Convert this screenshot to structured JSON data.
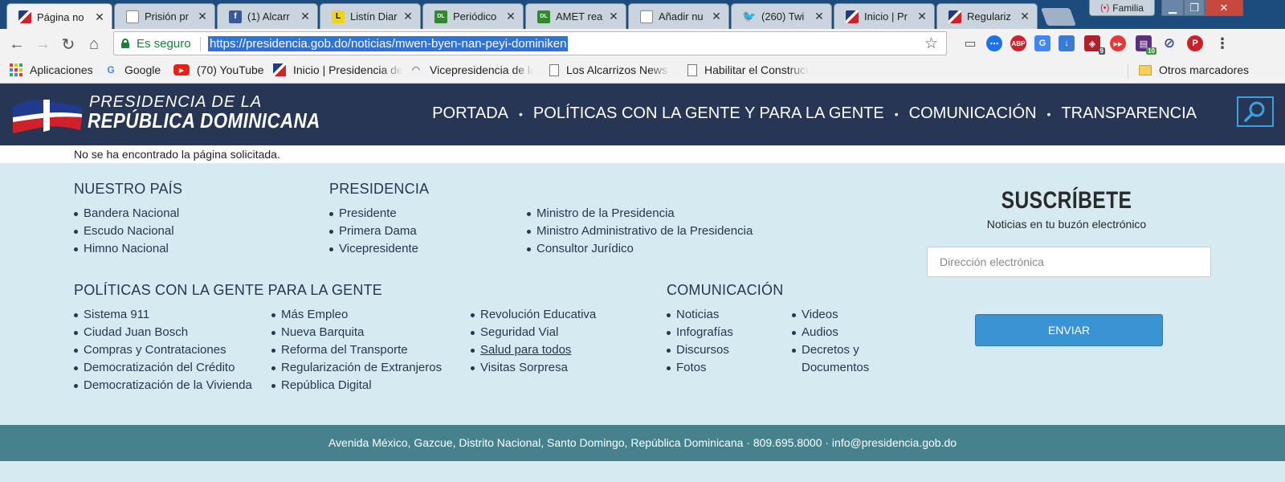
{
  "browser": {
    "tabs": [
      {
        "title": "Página no",
        "favicon": "flag-icon",
        "active": true
      },
      {
        "title": "Prisión pr",
        "favicon": "document-icon"
      },
      {
        "title": "(1) Alcarr",
        "favicon": "facebook-icon"
      },
      {
        "title": "Listín Diar",
        "favicon": "listin-icon"
      },
      {
        "title": "Periódico",
        "favicon": "diario-libre-icon"
      },
      {
        "title": "AMET rea",
        "favicon": "diario-libre-icon"
      },
      {
        "title": "Añadir nu",
        "favicon": "document-icon"
      },
      {
        "title": "(260) Twi",
        "favicon": "twitter-icon"
      },
      {
        "title": "Inicio | Pr",
        "favicon": "flag-icon"
      },
      {
        "title": "Regulariz",
        "favicon": "flag-icon"
      }
    ],
    "profile_name": "Familia",
    "secure_label": "Es seguro",
    "url": "https://presidencia.gob.do/noticias/mwen-byen-nan-peyi-dominiken",
    "extensions": [
      {
        "name": "cast-icon"
      },
      {
        "name": "messenger-icon"
      },
      {
        "name": "abp-icon",
        "text": "ABP"
      },
      {
        "name": "translate-icon"
      },
      {
        "name": "download-icon"
      },
      {
        "name": "shield-ext-icon",
        "badge": "9"
      },
      {
        "name": "media-ext-icon"
      },
      {
        "name": "calendar-ext-icon",
        "badge": "10"
      },
      {
        "name": "block-icon"
      },
      {
        "name": "pinterest-icon",
        "text": "P"
      }
    ],
    "bookmarks": [
      {
        "label": "Aplicaciones",
        "icon": "apps-icon"
      },
      {
        "label": "Google",
        "icon": "google-icon"
      },
      {
        "label": "(70) YouTube",
        "icon": "youtube-icon"
      },
      {
        "label": "Inicio | Presidencia de",
        "icon": "flag-icon"
      },
      {
        "label": "Vicepresidencia de la",
        "icon": "vicepresidencia-icon"
      },
      {
        "label": "Los Alcarrizos News D",
        "icon": "document-icon"
      },
      {
        "label": "Habilitar el Construct",
        "icon": "document-icon"
      }
    ],
    "other_bookmarks": "Otros marcadores"
  },
  "site": {
    "logo_line1": "PRESIDENCIA DE LA",
    "logo_line2": "REPÚBLICA DOMINICANA",
    "nav": [
      "PORTADA",
      "POLÍTICAS CON LA GENTE Y PARA LA GENTE",
      "COMUNICACIÓN",
      "TRANSPARENCIA"
    ],
    "nav_separator": "•",
    "error": "No se ha encontrado la página solicitada."
  },
  "footer_links": {
    "nuestro_pais": {
      "title": "NUESTRO PAÍS",
      "items": [
        "Bandera Nacional",
        "Escudo Nacional",
        "Himno Nacional"
      ]
    },
    "presidencia": {
      "title": "PRESIDENCIA",
      "col1": [
        "Presidente",
        "Primera Dama",
        "Vicepresidente"
      ],
      "col2": [
        "Ministro de la Presidencia",
        "Ministro Administrativo de la Presidencia",
        "Consultor Jurídico"
      ]
    },
    "politicas": {
      "title": "POLÍTICAS CON LA GENTE PARA LA GENTE",
      "col1": [
        "Sistema 911",
        "Ciudad Juan Bosch",
        "Compras y Contrataciones",
        "Democratización del Crédito",
        "Democratización de la Vivienda"
      ],
      "col2": [
        "Más Empleo",
        "Nueva Barquita",
        "Reforma del Transporte",
        "Regularización de Extranjeros",
        "República Digital"
      ],
      "col3": [
        "Revolución Educativa",
        "Seguridad Vial",
        "Salud para todos",
        "Visitas Sorpresa"
      ]
    },
    "comunicacion": {
      "title": "COMUNICACIÓN",
      "col1": [
        "Noticias",
        "Infografías",
        "Discursos",
        "Fotos"
      ],
      "col2": [
        "Videos",
        "Audios",
        "Decretos y Documentos"
      ]
    }
  },
  "subscribe": {
    "title": "SUSCRÍBETE",
    "subtitle": "Noticias en tu buzón electrónico",
    "email_placeholder": "Dirección electrónica",
    "button": "ENVIAR"
  },
  "footer": {
    "address": "Avenida México, Gazcue, Distrito Nacional, Santo Domingo, República Dominicana · 809.695.8000 · info@presidencia.gob.do"
  },
  "colors": {
    "header_bg": "#283656",
    "content_bg": "#d5eaf1",
    "footer_bg": "#46828e",
    "button_bg": "#3a94d4",
    "accent": "#3aa0e0"
  }
}
